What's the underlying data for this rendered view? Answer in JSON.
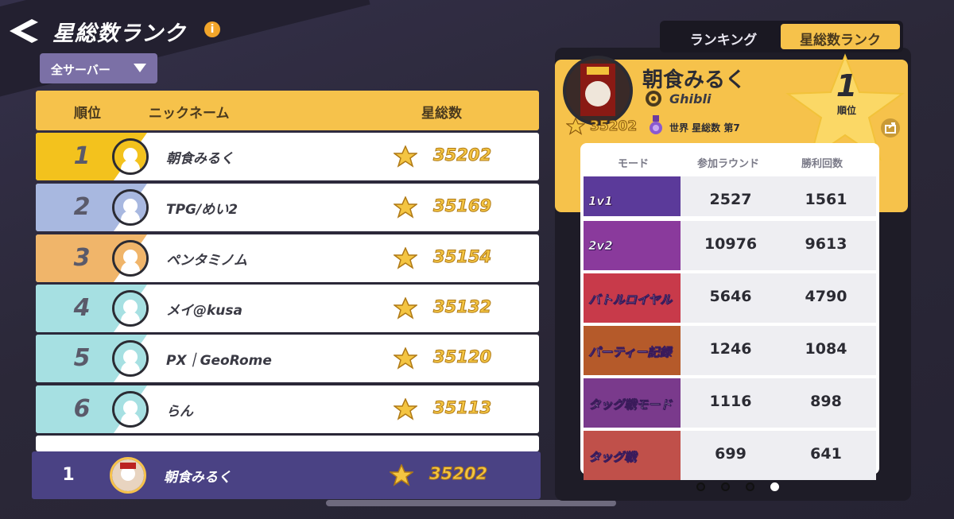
{
  "header": {
    "title": "星総数ランク",
    "info_icon": "i",
    "server_filter": "全サーバー"
  },
  "table": {
    "columns": [
      "順位",
      "ニックネーム",
      "星総数"
    ],
    "rows": [
      {
        "rank": "1",
        "name": "朝食みるく",
        "score": "35202",
        "tier_color": "#f3c21d"
      },
      {
        "rank": "2",
        "name": "TPG/めい2",
        "score": "35169",
        "tier_color": "#a8b8e0"
      },
      {
        "rank": "3",
        "name": "ペンタミノム",
        "score": "35154",
        "tier_color": "#f0b56a"
      },
      {
        "rank": "4",
        "name": "メイ@kusa",
        "score": "35132",
        "tier_color": "#a6e0e2"
      },
      {
        "rank": "5",
        "name": "PX｜GeoRome",
        "score": "35120",
        "tier_color": "#a6e0e2"
      },
      {
        "rank": "6",
        "name": "らん",
        "score": "35113",
        "tier_color": "#a6e0e2"
      }
    ],
    "self": {
      "rank": "1",
      "name": "朝食みるく",
      "score": "35202"
    }
  },
  "tabs": {
    "ranking": "ランキング",
    "stars": "星総数ランク"
  },
  "profile": {
    "name": "朝食みるく",
    "guild": "Ghibli",
    "total_stars": "35202",
    "world_rank_text": "世界 星総数 第7",
    "rank": "1",
    "rank_label": "順位"
  },
  "stats": {
    "columns": [
      "モード",
      "参加ラウンド",
      "勝利回数"
    ],
    "modes": [
      {
        "mode": "1v1",
        "rounds": "2527",
        "wins": "1561",
        "banner_color": "#5b3a9a"
      },
      {
        "mode": "2v2",
        "rounds": "10976",
        "wins": "9613",
        "banner_color": "#8a3a9c"
      },
      {
        "mode": "バトルロイヤル",
        "rounds": "5646",
        "wins": "4790",
        "banner_color": "#c83a4a"
      },
      {
        "mode": "パーティー記録",
        "rounds": "1246",
        "wins": "1084",
        "banner_color": "#b55a2a"
      },
      {
        "mode": "タッグ戦モード",
        "rounds": "1116",
        "wins": "898",
        "banner_color": "#7a3a8c"
      },
      {
        "mode": "タッグ戦",
        "rounds": "699",
        "wins": "641",
        "banner_color": "#c0504a"
      }
    ]
  },
  "pagination": {
    "pages": 4,
    "active": 4
  },
  "colors": {
    "accent": "#f6c24b",
    "self_row": "#4a4284",
    "score_gold": "#f4c542"
  }
}
